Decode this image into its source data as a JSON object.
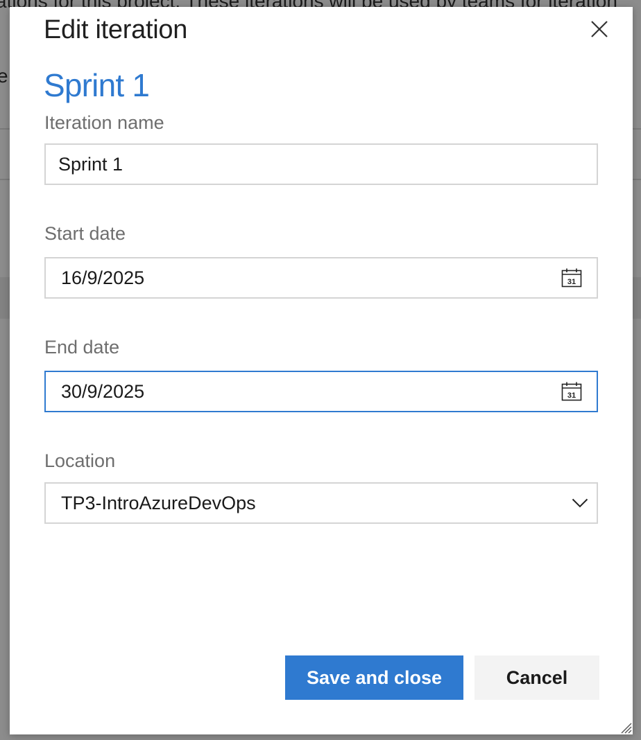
{
  "background": {
    "line1": "ations for this project. These iterations will be used by teams for iteration",
    "line2": "e"
  },
  "dialog": {
    "title": "Edit iteration",
    "close_icon": "close-icon",
    "subtitle": "Sprint 1",
    "fields": {
      "iteration_name": {
        "label": "Iteration name",
        "value": "Sprint 1"
      },
      "start_date": {
        "label": "Start date",
        "value": "16/9/2025",
        "icon": "calendar-icon"
      },
      "end_date": {
        "label": "End date",
        "value": "30/9/2025",
        "icon": "calendar-icon"
      },
      "location": {
        "label": "Location",
        "value": "TP3-IntroAzureDevOps",
        "icon": "chevron-down-icon"
      }
    },
    "buttons": {
      "save_label": "Save and close",
      "cancel_label": "Cancel"
    }
  },
  "colors": {
    "accent": "#2f7ad0",
    "overlay": "#8c8c8c",
    "border": "#d4d4d4",
    "label": "#6e6e6e"
  }
}
